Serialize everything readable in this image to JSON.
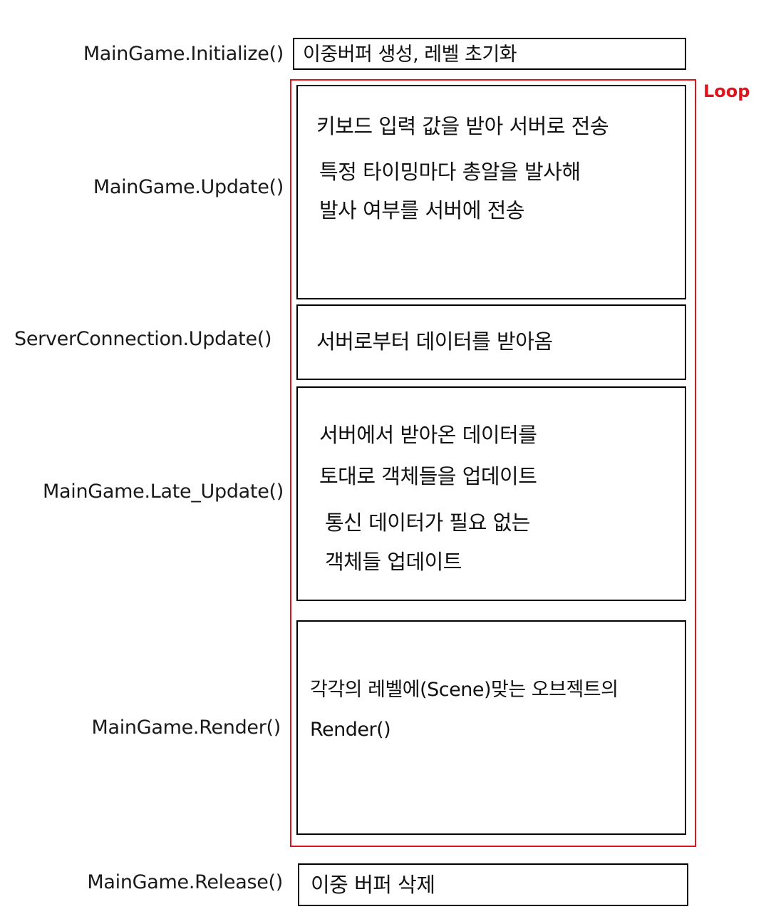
{
  "loop": {
    "label": "Loop",
    "color": "#e0151b"
  },
  "steps": {
    "initialize": {
      "func": "MainGame.Initialize()",
      "lines": [
        "이중버퍼 생성, 레벨 초기화"
      ]
    },
    "update": {
      "func": "MainGame.Update()",
      "lines": [
        "키보드 입력 값을 받아 서버로 전송",
        "특정 타이밍마다 총알을 발사해",
        "발사 여부를 서버에 전송"
      ]
    },
    "server_update": {
      "func": "ServerConnection.Update()",
      "lines": [
        "서버로부터 데이터를 받아옴"
      ]
    },
    "late_update": {
      "func": "MainGame.Late_Update()",
      "lines": [
        "서버에서 받아온 데이터를",
        "토대로 객체들을 업데이트",
        "통신 데이터가 필요 없는",
        "객체들 업데이트"
      ]
    },
    "render": {
      "func": "MainGame.Render()",
      "lines": [
        "각각의 레벨에(Scene)맞는 오브젝트의",
        "Render()"
      ]
    },
    "release": {
      "func": "MainGame.Release()",
      "lines": [
        "이중 버퍼 삭제"
      ]
    }
  }
}
